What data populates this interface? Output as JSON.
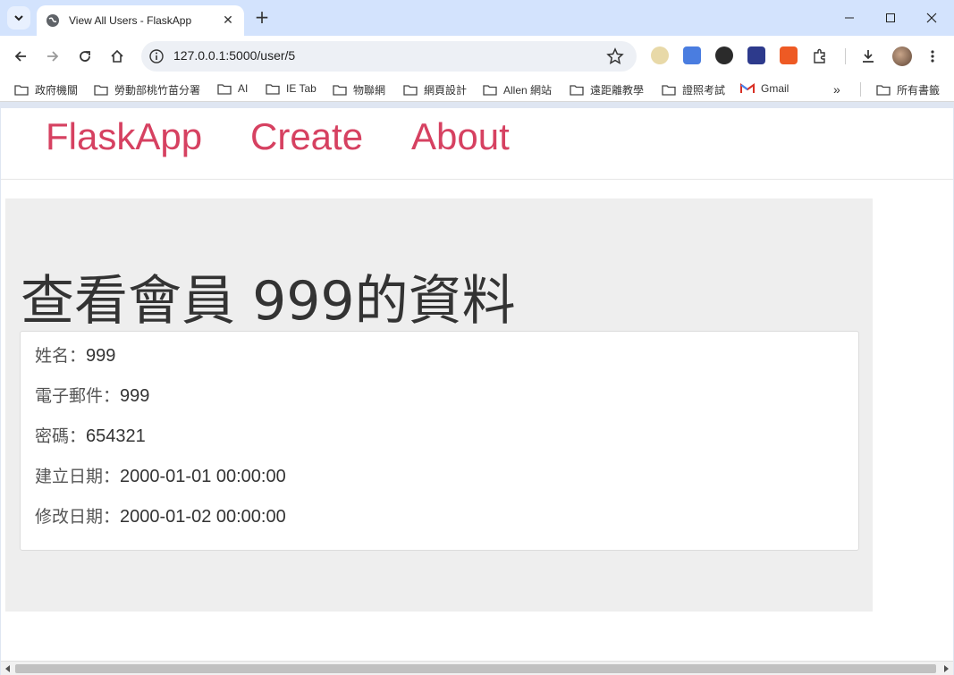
{
  "browser": {
    "tab_title": "View All Users - FlaskApp",
    "url": "127.0.0.1:5000/user/5",
    "bookmarks": [
      "政府機關",
      "勞動部桃竹苗分署",
      "AI",
      "IE Tab",
      "物聯網",
      "網頁設計",
      "Allen 網站",
      "遠距離教學",
      "證照考試",
      "Gmail",
      "所有書籤"
    ]
  },
  "nav": {
    "brand": "FlaskApp",
    "create": "Create",
    "about": "About"
  },
  "user": {
    "heading": "查看會員 999的資料",
    "fields": [
      {
        "label": "姓名：",
        "value": "999"
      },
      {
        "label": "電子郵件：",
        "value": "999"
      },
      {
        "label": "密碼：",
        "value": "654321"
      },
      {
        "label": "建立日期：",
        "value": "2000-01-01 00:00:00"
      },
      {
        "label": "修改日期：",
        "value": "2000-01-02 00:00:00"
      }
    ]
  },
  "colors": {
    "accent": "#d64161",
    "tabstrip": "#d3e3fd",
    "panel": "#eeeeee"
  }
}
